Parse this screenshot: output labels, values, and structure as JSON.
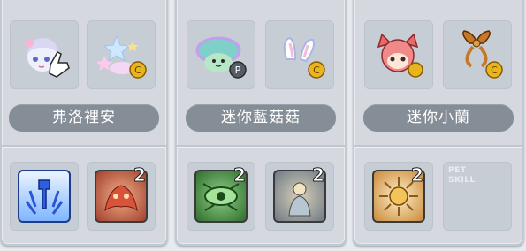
{
  "pets": [
    {
      "name": "弗洛裡安",
      "pet_icon": "anime-girl-pet-icon",
      "equip_icon": "sparkle-star-equip-icon",
      "skills": [
        {
          "icon": "blue-sword-skill-icon",
          "level": ""
        },
        {
          "icon": "red-beast-skill-icon",
          "level": "2"
        }
      ]
    },
    {
      "name": "迷你藍菇菇",
      "pet_icon": "blue-mushroom-pet-icon",
      "equip_icon": "bunny-ear-equip-icon",
      "skills": [
        {
          "icon": "green-eye-skill-icon",
          "level": "2"
        },
        {
          "icon": "grey-figure-skill-icon",
          "level": "2"
        }
      ]
    },
    {
      "name": "迷你小蘭",
      "pet_icon": "red-fox-girl-pet-icon",
      "equip_icon": "gold-ribbon-equip-icon",
      "skills": [
        {
          "icon": "gold-burst-skill-icon",
          "level": "2"
        }
      ],
      "empty_slot_label": "PET\nSKILL"
    }
  ],
  "colors": {
    "panel": "#d5d9df",
    "slot": "#c7cdd4",
    "namebar": "#858d97",
    "coin": "#e8b61c"
  }
}
